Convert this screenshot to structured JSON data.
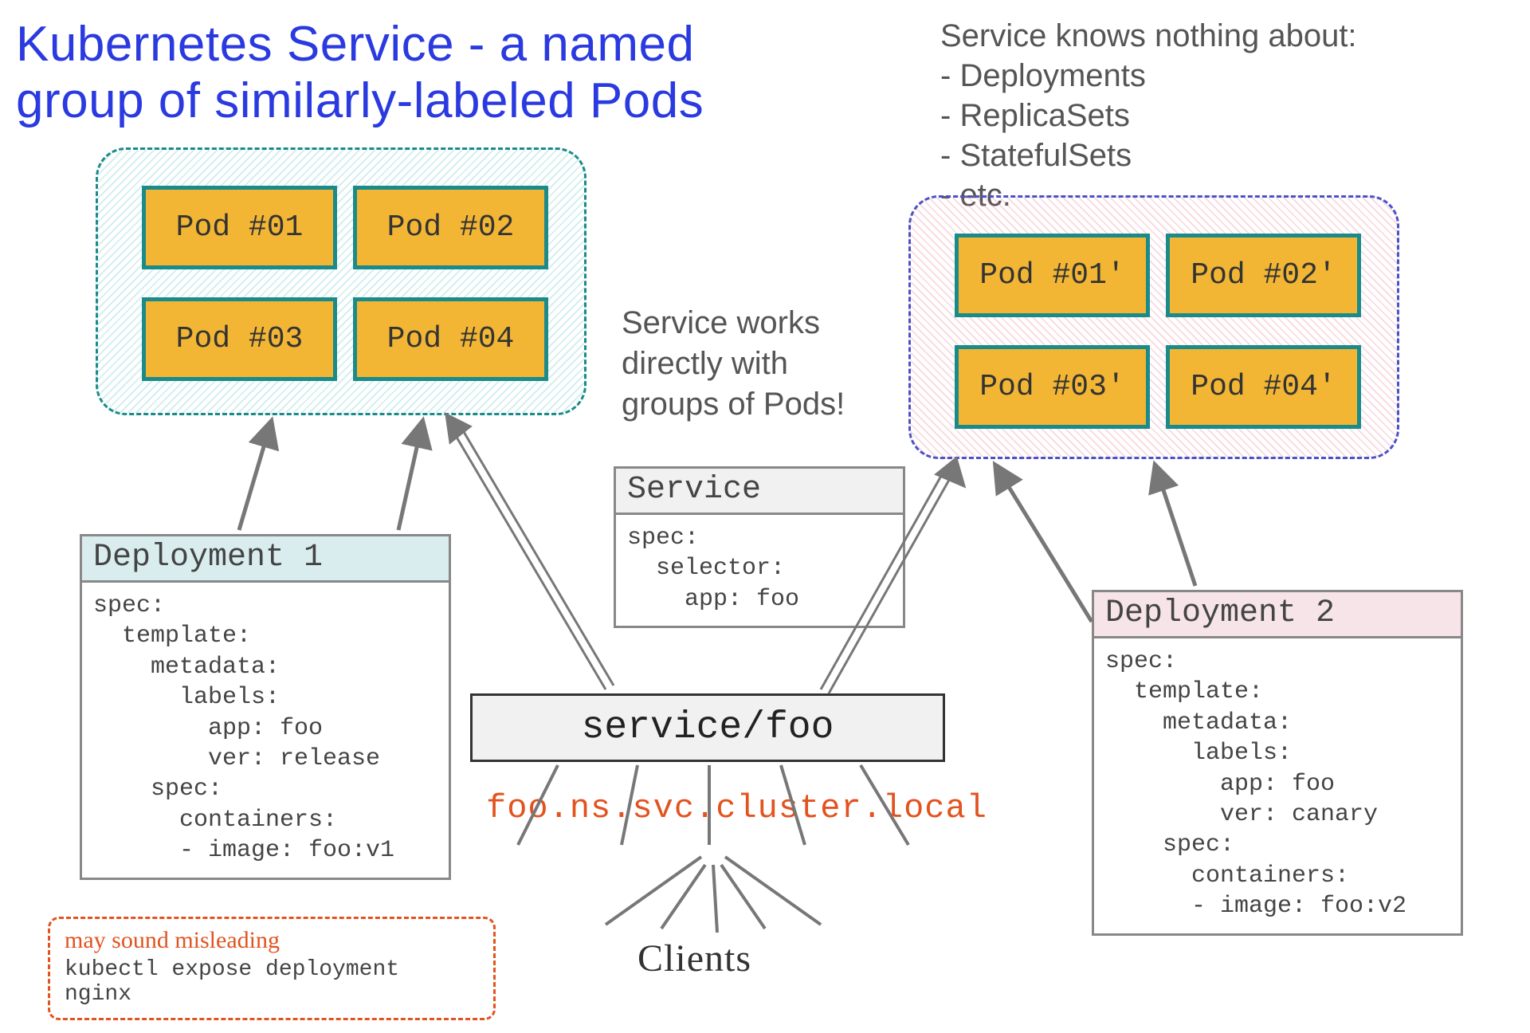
{
  "title_line1": "Kubernetes Service - a named",
  "title_line2": "group of similarly-labeled Pods",
  "knows_nothing_heading": "Service knows nothing about:",
  "knows_nothing_items": [
    "Deployments",
    "ReplicaSets",
    "StatefulSets",
    "etc."
  ],
  "pod_group_1": {
    "pods": [
      "Pod #01",
      "Pod #02",
      "Pod #03",
      "Pod #04"
    ]
  },
  "pod_group_2": {
    "pods": [
      "Pod #01'",
      "Pod #02'",
      "Pod #03'",
      "Pod #04'"
    ]
  },
  "middle_note_l1": "Service works",
  "middle_note_l2": "directly with",
  "middle_note_l3": "groups of Pods!",
  "service_spec": {
    "title": "Service",
    "body": "spec:\n  selector:\n    app: foo"
  },
  "deployment1": {
    "title": "Deployment 1",
    "body": "spec:\n  template:\n    metadata:\n      labels:\n        app: foo\n        ver: release\n    spec:\n      containers:\n      - image: foo:v1"
  },
  "deployment2": {
    "title": "Deployment 2",
    "body": "spec:\n  template:\n    metadata:\n      labels:\n        app: foo\n        ver: canary\n    spec:\n      containers:\n      - image: foo:v2"
  },
  "service_name": "service/foo",
  "service_dns": "foo.ns.svc.cluster.local",
  "clients_label": "Clients",
  "misleading_l1": "may sound misleading",
  "misleading_l2": "kubectl expose deployment nginx"
}
